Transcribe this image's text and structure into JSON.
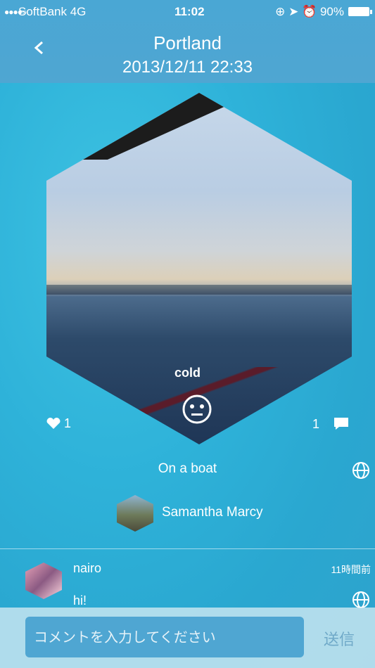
{
  "status_bar": {
    "carrier": "SoftBank  4G",
    "time": "11:02",
    "battery": "90%"
  },
  "nav": {
    "title": "Portland",
    "subtitle": "2013/12/11 22:33"
  },
  "post": {
    "mood": "cold",
    "likes": "1",
    "comments": "1",
    "caption": "On a boat",
    "author": "Samantha Marcy"
  },
  "comments": [
    {
      "user": "nairo",
      "time": "11時間前",
      "text": "hi!"
    }
  ],
  "input": {
    "placeholder": "コメントを入力してください",
    "send_label": "送信"
  }
}
